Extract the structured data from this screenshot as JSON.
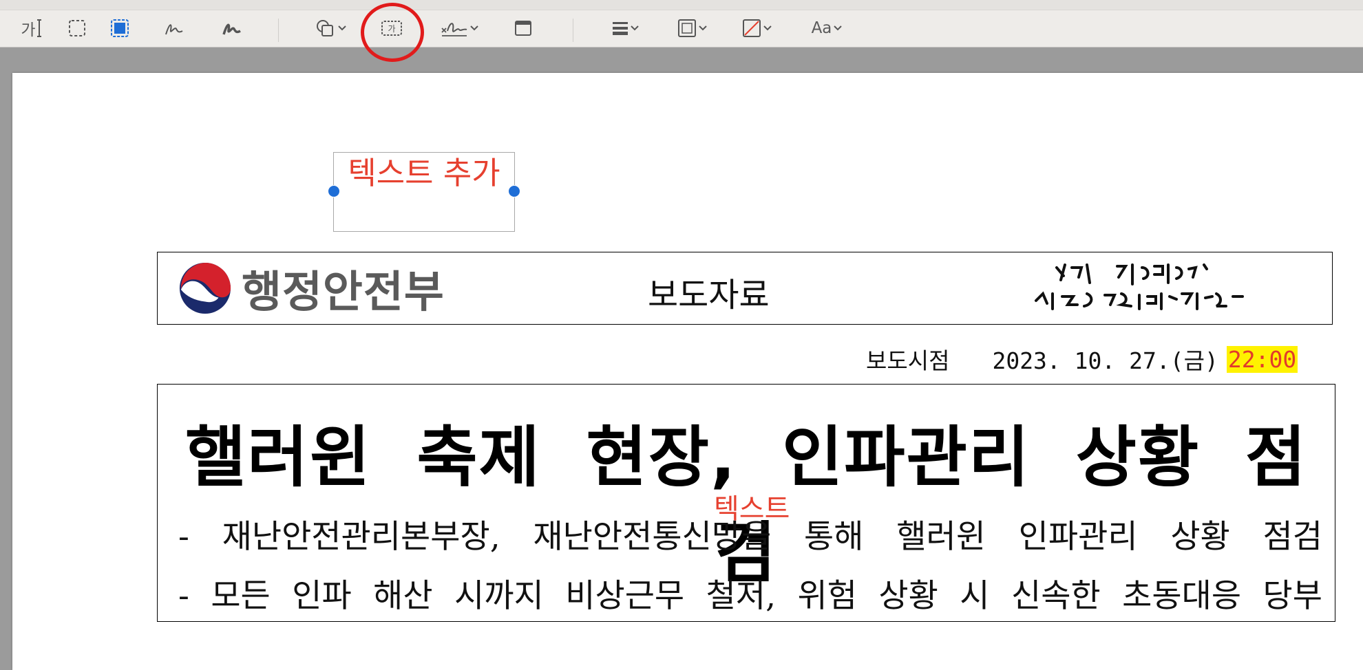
{
  "toolbar": {
    "items": [
      {
        "name": "text-select-icon",
        "label": "가"
      },
      {
        "name": "rect-select-icon"
      },
      {
        "name": "smart-lasso-icon"
      },
      {
        "name": "sketch-icon"
      },
      {
        "name": "draw-icon"
      },
      {
        "name": "shapes-icon"
      },
      {
        "name": "textbox-icon",
        "label": "가"
      },
      {
        "name": "signature-icon"
      },
      {
        "name": "note-icon"
      },
      {
        "name": "line-style-icon"
      },
      {
        "name": "border-color-icon"
      },
      {
        "name": "fill-color-icon"
      },
      {
        "name": "text-style-icon",
        "label": "Aa"
      }
    ],
    "highlight_color": "#e11b1b"
  },
  "annotation": {
    "text_box": "텍스트 추가",
    "inline_text": "텍스트",
    "color": "#e6402f"
  },
  "document": {
    "ministry_name": "행정안전부",
    "release_label": "보도자료",
    "slogan": "다시 대한민국! 새로운 국민의 나라",
    "release_time_label": "보도시점",
    "release_date": "2023. 10. 27.(금)",
    "release_hour": "22:00",
    "title": "핼러윈 축제 현장, 인파관리 상황 점검",
    "bullets": [
      "- 재난안전관리본부장, 재난안전통신망을 통해 핼러윈 인파관리 상황 점검",
      "- 모든 인파 해산 시까지 비상근무 철저, 위험 상황 시 신속한 초동대응 당부"
    ]
  }
}
